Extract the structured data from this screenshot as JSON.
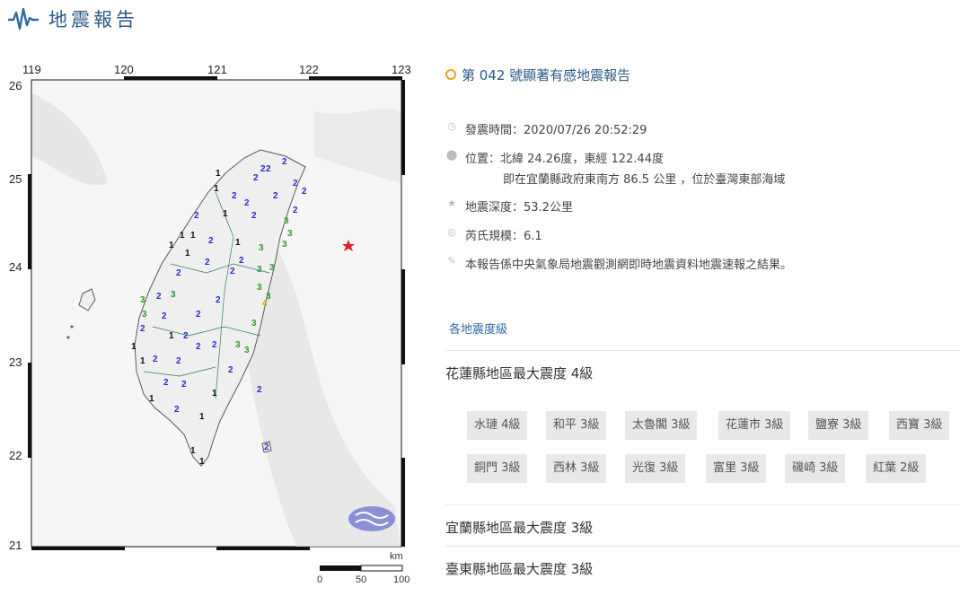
{
  "header": {
    "title": "地震報告",
    "icon": "seismograph-icon"
  },
  "map": {
    "lon_labels": [
      "119",
      "120",
      "121",
      "122",
      "123"
    ],
    "lat_labels": [
      "26",
      "25",
      "24",
      "23",
      "22",
      "21"
    ],
    "scale": {
      "unit": "km",
      "ticks": [
        "0",
        "50",
        "100"
      ]
    },
    "epicenter_marker": "star-icon",
    "intensity_labels": [
      "1",
      "2",
      "3",
      "4"
    ],
    "colors": {
      "1": "#111111",
      "2": "#2a2ad0",
      "3": "#2f9a2f",
      "4": "#c89b00",
      "epicenter": "#e02020",
      "land": "#eeeeee",
      "sea": "#f7f7f7"
    }
  },
  "report": {
    "title": "第 042 號顯著有感地震報告",
    "time": "發震時間：2020/07/26 20:52:29",
    "location_line1": "位置：北緯 24.26度，東經 122.44度",
    "location_line2": "即在宜蘭縣政府東南方 86.5 公里 ，位於臺灣東部海域",
    "depth": "地震深度：53.2公里",
    "magnitude": "芮氏規模：6.1",
    "note": "本報告係中央氣象局地震觀測網即時地震資料地震速報之結果。",
    "section_link": "各地震度級",
    "counties": [
      {
        "name": "花蓮縣地區最大震度 4級"
      },
      {
        "name": "宜蘭縣地區最大震度 3級"
      },
      {
        "name": "臺東縣地區最大震度 3級"
      }
    ],
    "stations": [
      "水璉 4級",
      "和平 3級",
      "太魯閣 3級",
      "花蓮市 3級",
      "鹽寮 3級",
      "西寶 3級",
      "銅門 3級",
      "西林 3級",
      "光復 3級",
      "富里 3級",
      "磯崎 3級",
      "紅葉 2級"
    ]
  }
}
